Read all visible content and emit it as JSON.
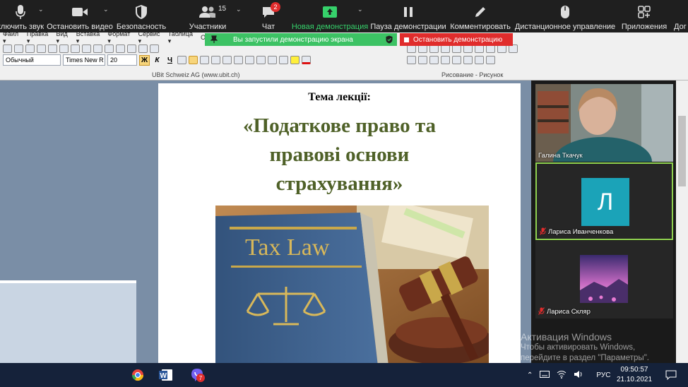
{
  "zoom_toolbar": {
    "items": [
      {
        "label": "ключить звук",
        "icon": "microphone-icon"
      },
      {
        "label": "Остановить видео",
        "icon": "video-camera-icon"
      },
      {
        "label": "Безопасность",
        "icon": "shield-icon"
      },
      {
        "label": "Участники",
        "icon": "participants-icon"
      },
      {
        "label": "Чат",
        "icon": "chat-icon"
      },
      {
        "label": "Новая демонстрация",
        "icon": "share-screen-icon"
      },
      {
        "label": "Пауза демонстрации",
        "icon": "pause-icon"
      },
      {
        "label": "Комментировать",
        "icon": "pencil-icon"
      },
      {
        "label": "Дистанционное управление",
        "icon": "mouse-icon"
      },
      {
        "label": "Приложения",
        "icon": "apps-icon"
      },
      {
        "label": "Дог",
        "icon": ""
      }
    ],
    "participants_count": "15",
    "chat_badge": "2"
  },
  "share_banner": {
    "status": "Вы запустили демонстрацию экрана",
    "stop_label": "Остановить демонстрацию"
  },
  "word": {
    "menu": [
      "Файл ▾",
      "Правка ▾",
      "Вид ▾",
      "Вставка ▾",
      "Формат ▾",
      "Сервис ▾",
      "Таблица ▾",
      "Окн"
    ],
    "style_value": "Обычный",
    "font_value": "Times New R",
    "size_value": "20",
    "bold": "Ж",
    "italic": "К",
    "underline": "Ч",
    "toolbar_label_1": "UBit Schweiz AG    (www.ubit.ch)",
    "toolbar_label_2": "Рисование - Рисунок"
  },
  "document": {
    "heading": "Тема лекції:",
    "title_lines": [
      "«Податкове право та",
      "правові основи",
      "страхування»"
    ],
    "image_text": "Tax Law"
  },
  "gallery": {
    "participants": [
      {
        "name": "Галина Ткачук",
        "muted": false
      },
      {
        "name": "Лариса Иванченкова",
        "muted": true,
        "initial": "Л"
      },
      {
        "name": "Лариса Скляр",
        "muted": true
      }
    ]
  },
  "watermark": {
    "line1": "Активация Windows",
    "line2": "Чтобы активировать Windows,",
    "line3": "перейдите в раздел \"Параметры\"."
  },
  "taskbar": {
    "viber_badge": "7",
    "language": "РУС",
    "time": "09:50:57",
    "date": "21.10.2021"
  },
  "colors": {
    "toolbar_bg": "#1f1f1f",
    "share_green": "#3cc264",
    "stop_red": "#e02c2c",
    "title_olive": "#4f6128",
    "avatar_teal": "#1ba3b8"
  }
}
